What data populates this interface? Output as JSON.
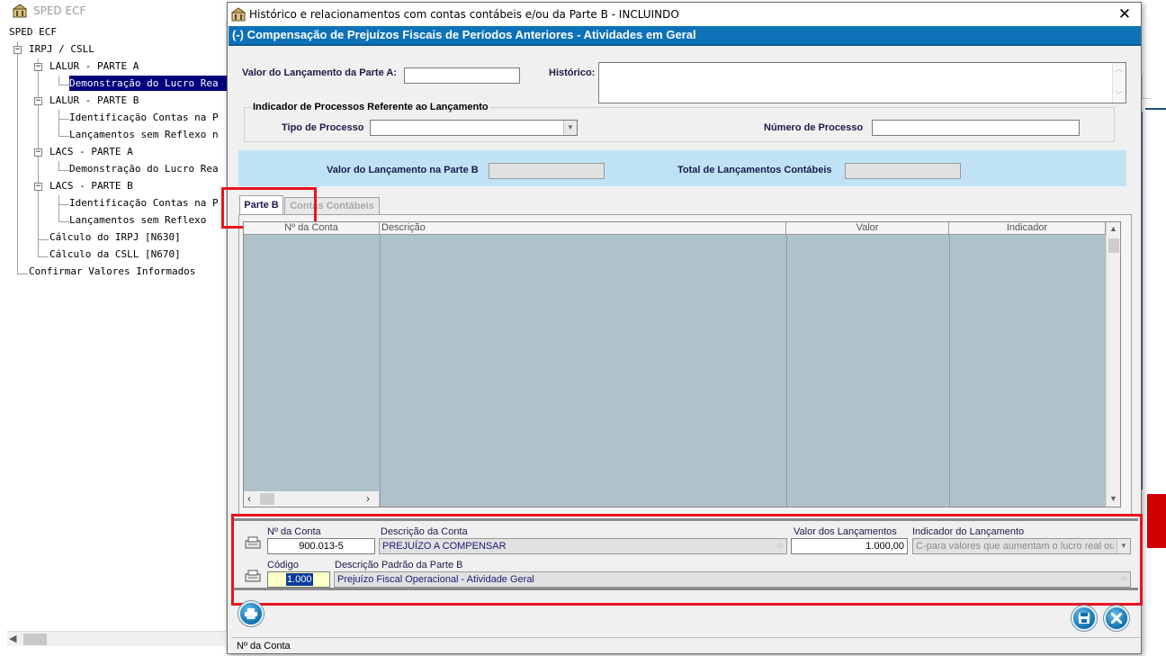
{
  "main_window": {
    "app_title": "SPED ECF",
    "tree": [
      {
        "label": "SPED ECF"
      },
      {
        "label": "IRPJ / CSLL"
      },
      {
        "label": "LALUR - PARTE A"
      },
      {
        "label": "Demonstração do Lucro Rea"
      },
      {
        "label": "LALUR - PARTE B"
      },
      {
        "label": "Identificação Contas na P"
      },
      {
        "label": "Lançamentos sem Reflexo n"
      },
      {
        "label": "LACS - PARTE A"
      },
      {
        "label": "Demonstração do Lucro Rea"
      },
      {
        "label": "LACS - PARTE B"
      },
      {
        "label": "Identificação Contas na P"
      },
      {
        "label": "Lançamentos sem Reflexo"
      },
      {
        "label": "Cálculo do IRPJ [N630]"
      },
      {
        "label": "Cálculo da CSLL [N670]"
      },
      {
        "label": "Confirmar Valores Informados"
      }
    ],
    "toggle_symbol": "−",
    "scroll_left_arrow": "◀"
  },
  "dialog": {
    "title": "Histórico e relacionamentos com contas contábeis e/ou da Parte B  -  INCLUINDO",
    "close_glyph": "✕",
    "header": "(-) Compensação de Prejuízos Fiscais de Períodos Anteriores - Atividades em Geral",
    "valor_lancamento_label": "Valor do Lançamento da Parte A:",
    "valor_lancamento_value": "",
    "historico_label": "Histórico:",
    "historico_value": "",
    "processos_group": "Indicador de Processos Referente ao Lançamento",
    "tipo_processo_label": "Tipo de Processo",
    "tipo_processo_value": "",
    "numero_processo_label": "Número de Processo",
    "numero_processo_value": "",
    "valor_parte_b_label": "Valor do Lançamento na Parte B",
    "valor_parte_b_value": "",
    "total_lancamentos_label": "Total de Lançamentos Contábeis",
    "total_lancamentos_value": "",
    "tabs": [
      {
        "label": "Parte B",
        "active": true
      },
      {
        "label": "Contas Contábeis",
        "active": false
      }
    ],
    "grid_columns": [
      "Nº da Conta",
      "Descrição",
      "Valor",
      "Indicador"
    ],
    "grid_rows": [],
    "detail": {
      "conta_label": "Nº da Conta",
      "conta_value": "900.013-5",
      "descricao_conta_label": "Descrição da Conta",
      "descricao_conta_value": "PREJUÍZO A COMPENSAR",
      "valor_lancamentos_label": "Valor dos Lançamentos",
      "valor_lancamentos_value": "1.000,00",
      "indicador_label": "Indicador do Lançamento",
      "indicador_value": "C-para valores que aumentam o lucro real ou s",
      "codigo_label": "Código",
      "codigo_value": "1.000",
      "descricao_padrao_label": "Descrição Padrão da Parte B",
      "descricao_padrao_value": "Prejuízo Fiscal Operacional - Atividade Geral"
    },
    "statusbar": "Nº da Conta",
    "colors": {
      "header_blue": "#0e72b8",
      "info_band": "#bfe3f5",
      "grid_bg": "#afc2ca",
      "highlight_red": "#e8141f",
      "selection": "#00007c"
    }
  }
}
